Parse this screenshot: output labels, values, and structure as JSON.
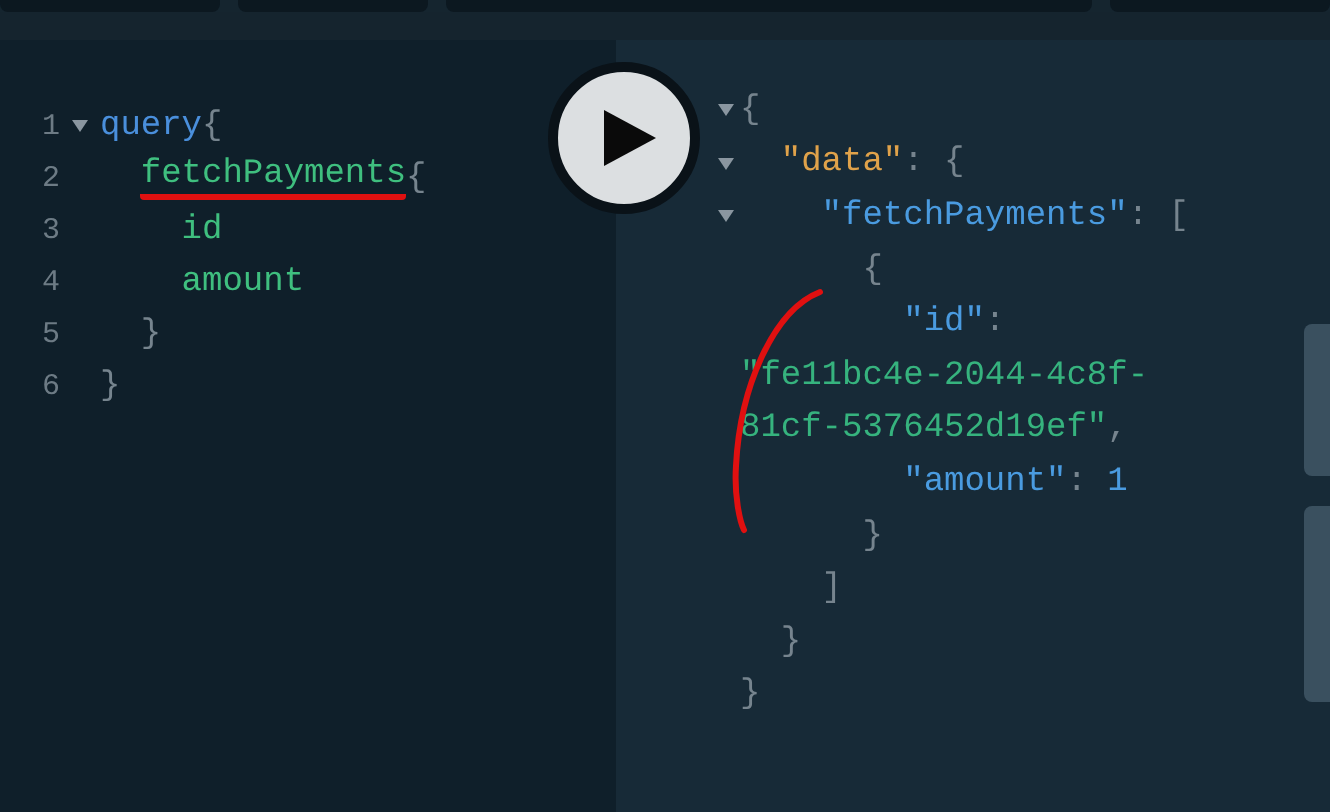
{
  "query_editor": {
    "lines": [
      {
        "number": "1",
        "foldable": true,
        "tokens": [
          {
            "text": "query",
            "kind": "keyword"
          },
          {
            "text": "{",
            "kind": "punct"
          }
        ]
      },
      {
        "number": "2",
        "foldable": false,
        "tokens": [
          {
            "text": "  fetchPayments",
            "kind": "field",
            "underlined": true
          },
          {
            "text": "{",
            "kind": "punct"
          }
        ]
      },
      {
        "number": "3",
        "foldable": false,
        "tokens": [
          {
            "text": "    id",
            "kind": "field"
          }
        ]
      },
      {
        "number": "4",
        "foldable": false,
        "tokens": [
          {
            "text": "    amount",
            "kind": "field"
          }
        ]
      },
      {
        "number": "5",
        "foldable": false,
        "tokens": [
          {
            "text": "  }",
            "kind": "punct"
          }
        ]
      },
      {
        "number": "6",
        "foldable": false,
        "tokens": [
          {
            "text": "}",
            "kind": "punct"
          }
        ]
      }
    ]
  },
  "result_viewer": {
    "lines": [
      {
        "foldable": true,
        "tokens": [
          {
            "text": "{",
            "kind": "punct"
          }
        ]
      },
      {
        "foldable": true,
        "tokens": [
          {
            "text": "  \"data\"",
            "kind": "root_key"
          },
          {
            "text": ": {",
            "kind": "punct"
          }
        ]
      },
      {
        "foldable": true,
        "tokens": [
          {
            "text": "    \"fetchPayments\"",
            "kind": "key"
          },
          {
            "text": ": [",
            "kind": "punct"
          }
        ]
      },
      {
        "foldable": false,
        "tokens": [
          {
            "text": "      {",
            "kind": "punct"
          }
        ]
      },
      {
        "foldable": false,
        "tokens": [
          {
            "text": "        \"id\"",
            "kind": "key"
          },
          {
            "text": ":",
            "kind": "punct"
          }
        ]
      },
      {
        "foldable": false,
        "tokens": [
          {
            "text": "\"fe11bc4e-2044-4c8f-",
            "kind": "string"
          }
        ]
      },
      {
        "foldable": false,
        "tokens": [
          {
            "text": "81cf-5376452d19ef\"",
            "kind": "string"
          },
          {
            "text": ",",
            "kind": "punct"
          }
        ]
      },
      {
        "foldable": false,
        "tokens": [
          {
            "text": "        \"amount\"",
            "kind": "key"
          },
          {
            "text": ": ",
            "kind": "punct"
          },
          {
            "text": "1",
            "kind": "number"
          }
        ]
      },
      {
        "foldable": false,
        "tokens": [
          {
            "text": "      }",
            "kind": "punct"
          }
        ]
      },
      {
        "foldable": false,
        "tokens": [
          {
            "text": "    ]",
            "kind": "punct"
          }
        ]
      },
      {
        "foldable": false,
        "tokens": [
          {
            "text": "  }",
            "kind": "punct"
          }
        ]
      },
      {
        "foldable": false,
        "tokens": [
          {
            "text": "}",
            "kind": "punct"
          }
        ]
      }
    ]
  },
  "side_tabs": [
    {
      "kind": "tab"
    },
    {
      "kind": "tab"
    }
  ]
}
